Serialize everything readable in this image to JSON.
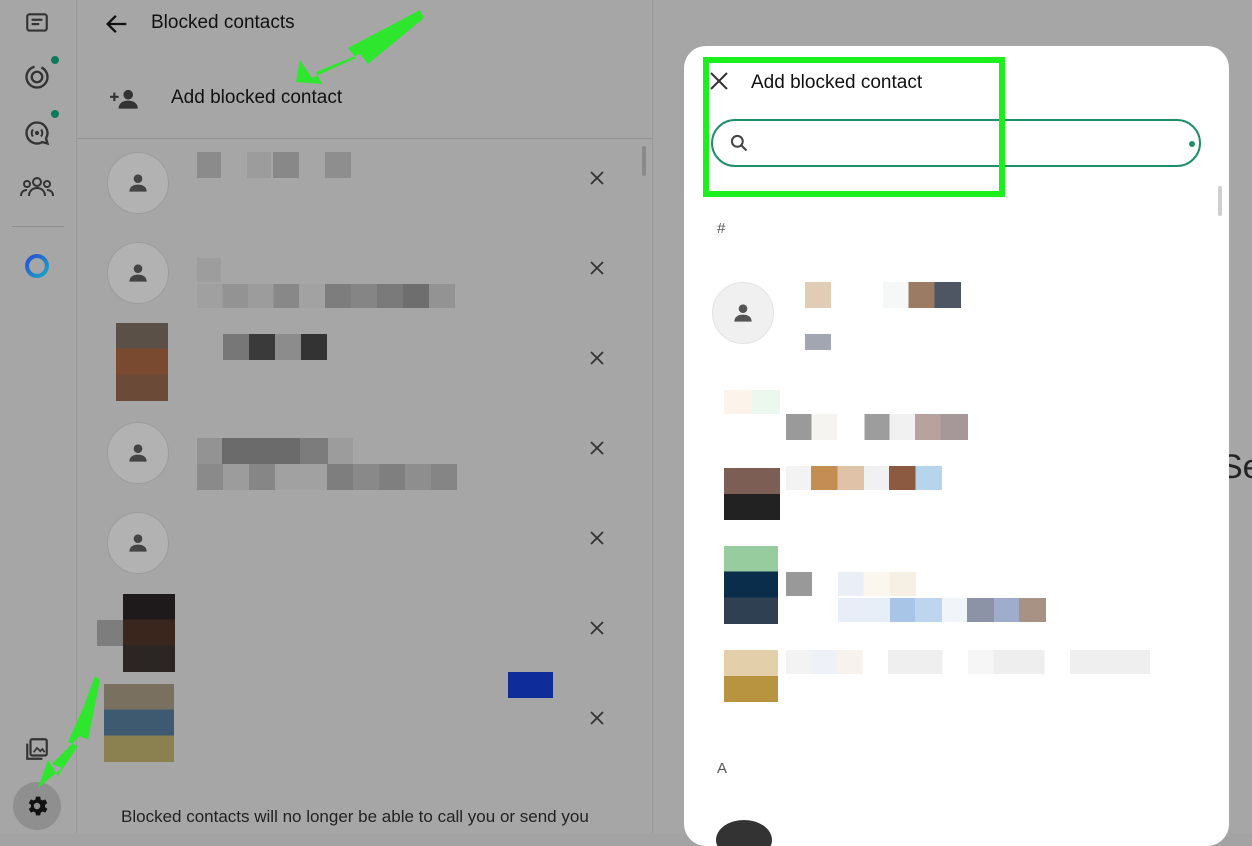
{
  "rail": {
    "icons": [
      "chats-icon",
      "status-icon",
      "channels-icon",
      "communities-icon",
      "meta-ai-icon",
      "media-icon",
      "settings-icon"
    ]
  },
  "panel": {
    "title": "Blocked contacts",
    "add_label": "Add blocked contact",
    "footnote": "Blocked contacts will no longer be able to call you or send you"
  },
  "modal": {
    "title": "Add blocked contact",
    "search_placeholder": "",
    "section_hash": "#",
    "section_a": "A"
  },
  "background": {
    "peek_text": "Se"
  },
  "colors": {
    "accent": "#1e8f66",
    "annotation": "#1cf01c",
    "overlay": "#a6a6a6"
  }
}
